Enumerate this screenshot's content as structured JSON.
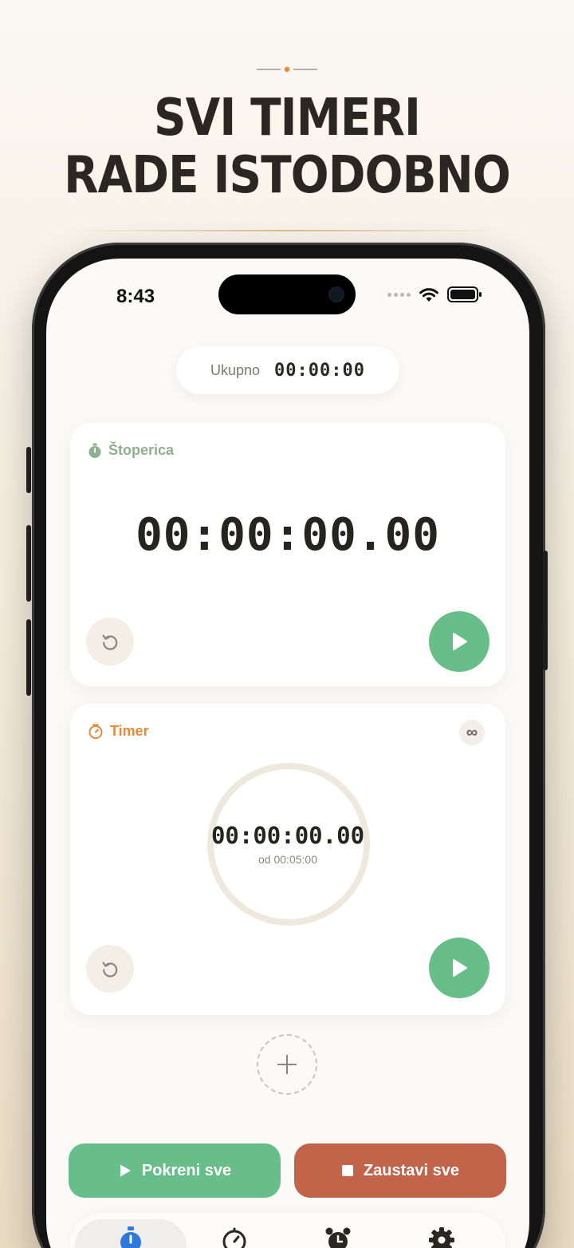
{
  "headline": {
    "line1": "SVI TIMERI",
    "line2": "RADE ISTODOBNO"
  },
  "colors": {
    "accent_green": "#68be89",
    "accent_red": "#c2644a",
    "timer_orange": "#e8893a",
    "stopwatch_green": "#8fb08f",
    "active_tab_blue": "#2f7ad8"
  },
  "status_bar": {
    "time": "8:43",
    "icons": [
      "signal-dots-icon",
      "wifi-icon",
      "battery-icon"
    ]
  },
  "total": {
    "label": "Ukupno",
    "value": "00:00:00"
  },
  "stopwatch": {
    "title": "Štoperica",
    "icon": "stopwatch-icon",
    "time": "00:00:00.00"
  },
  "timer": {
    "title": "Timer",
    "icon": "timer-icon",
    "time": "00:00:00.00",
    "of_label": "od 00:05:00",
    "repeat_symbol": "∞"
  },
  "actions": {
    "start_all": "Pokreni sve",
    "stop_all": "Zaustavi sve"
  },
  "tabs": [
    {
      "icon": "stopwatch-tab-icon",
      "active": true
    },
    {
      "icon": "timer-tab-icon",
      "active": false
    },
    {
      "icon": "alarm-clock-icon",
      "active": false
    },
    {
      "icon": "settings-gear-icon",
      "active": false
    }
  ]
}
